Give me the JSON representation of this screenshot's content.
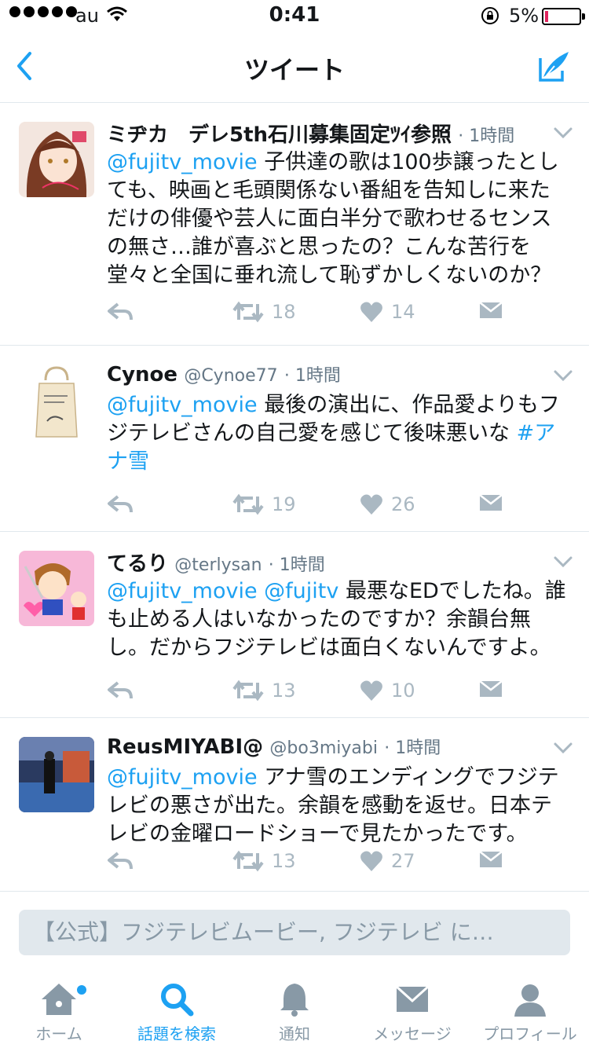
{
  "status_bar": {
    "carrier": "au",
    "time": "0:41",
    "battery_percent": "5%",
    "battery_level": 0.05
  },
  "nav": {
    "title": "ツイート",
    "back_icon": "chevron-left-icon",
    "compose_icon": "compose-icon"
  },
  "tweets": [
    {
      "name": "ミヂカ　デレ5th石川募集固定ﾂｲ参照",
      "handle": "",
      "time": "1時間",
      "mention": "@fujitv_movie",
      "text": " 子供達の歌は100歩譲ったとしても、映画と毛頭関係ない番組を告知しに来ただけの俳優や芸人に面白半分で歌わせるセンスの無さ…誰が喜ぶと思ったの？こんな苦行を堂々と全国に垂れ流して恥ずかしくないのか？",
      "hashtag": "",
      "retweets": "18",
      "likes": "14"
    },
    {
      "name": "Cynoe",
      "handle": "@Cynoe77",
      "time": "1時間",
      "mention": "@fujitv_movie",
      "text": " 最後の演出に、作品愛よりもフジテレビさんの自己愛を感じて後味悪いな ",
      "hashtag": "#アナ雪",
      "retweets": "19",
      "likes": "26"
    },
    {
      "name": "てるり",
      "handle": "@terlysan",
      "time": "1時間",
      "mention": "@fujitv_movie @fujitv",
      "text": " 最悪なEDでしたね。誰も止める人はいなかったのですか？余韻台無し。だからフジテレビは面白くないんですよ。",
      "hashtag": "",
      "retweets": "13",
      "likes": "10"
    },
    {
      "name": "ReusMIYABI@",
      "handle": "@bo3miyabi",
      "time": "1時間",
      "mention": "@fujitv_movie",
      "text": " アナ雪のエンディングでフジテレビの悪さが出た。余韻を感動を返せ。日本テレビの金曜ロードショーで見たかったです。",
      "hashtag": "",
      "retweets": "13",
      "likes": "27"
    }
  ],
  "search_bar": {
    "text": "【公式】フジテレビムービー, フジテレビ に…"
  },
  "tabs": [
    {
      "label": "ホーム",
      "icon": "home-icon"
    },
    {
      "label": "話題を検索",
      "icon": "search-icon"
    },
    {
      "label": "通知",
      "icon": "bell-icon"
    },
    {
      "label": "メッセージ",
      "icon": "envelope-icon"
    },
    {
      "label": "プロフィール",
      "icon": "person-icon"
    }
  ],
  "active_tab": "話題を検索",
  "colors": {
    "accent": "#1da1f2",
    "muted": "#aab8c2",
    "text": "#14171a",
    "battery_low": "#e0245e"
  }
}
